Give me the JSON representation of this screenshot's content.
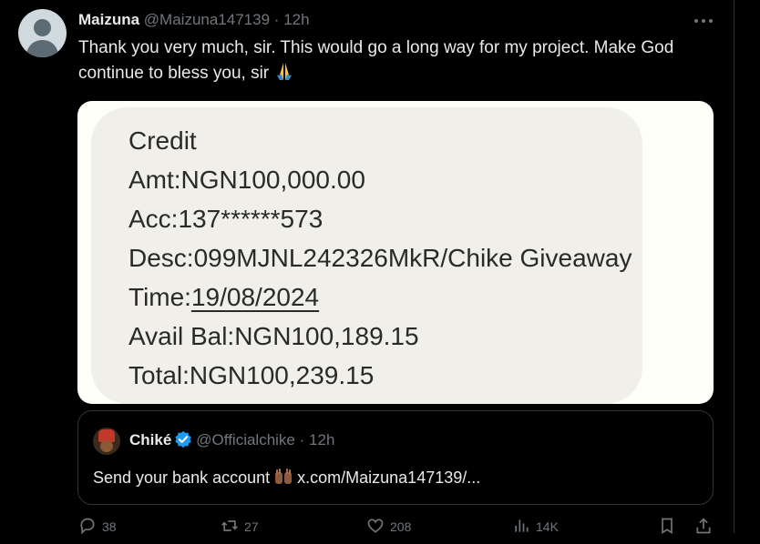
{
  "tweet": {
    "author_name": "Maizuna",
    "author_handle": "@Maizuna147139",
    "separator": "·",
    "time": "12h",
    "text": "Thank you very much, sir. This would go a long way for my project. Make God continue to bless you, sir",
    "emoji_icon": "folded-hands-emoji"
  },
  "sms": {
    "line1": "Credit",
    "line2": "Amt:NGN100,000.00",
    "line3": "Acc:137******573",
    "line4": "Desc:099MJNL242326MkR/Chike Giveaway",
    "line5_prefix": "Time:",
    "line5_date": "19/08/2024",
    "line6": "Avail Bal:NGN100,189.15",
    "line7": "Total:NGN100,239.15"
  },
  "quote": {
    "author_name": "Chiké",
    "author_handle": "@Officialchike",
    "separator": "·",
    "time": "12h",
    "text_before": "Send your bank account",
    "text_link": "x.com/Maizuna147139/..."
  },
  "actions": {
    "replies": "38",
    "reposts": "27",
    "likes": "208",
    "views": "14K"
  },
  "colors": {
    "background": "#000000",
    "muted": "#71767b",
    "text": "#e7e9ea",
    "verified": "#1d9bf0",
    "sms_bubble": "#f0efe9"
  }
}
